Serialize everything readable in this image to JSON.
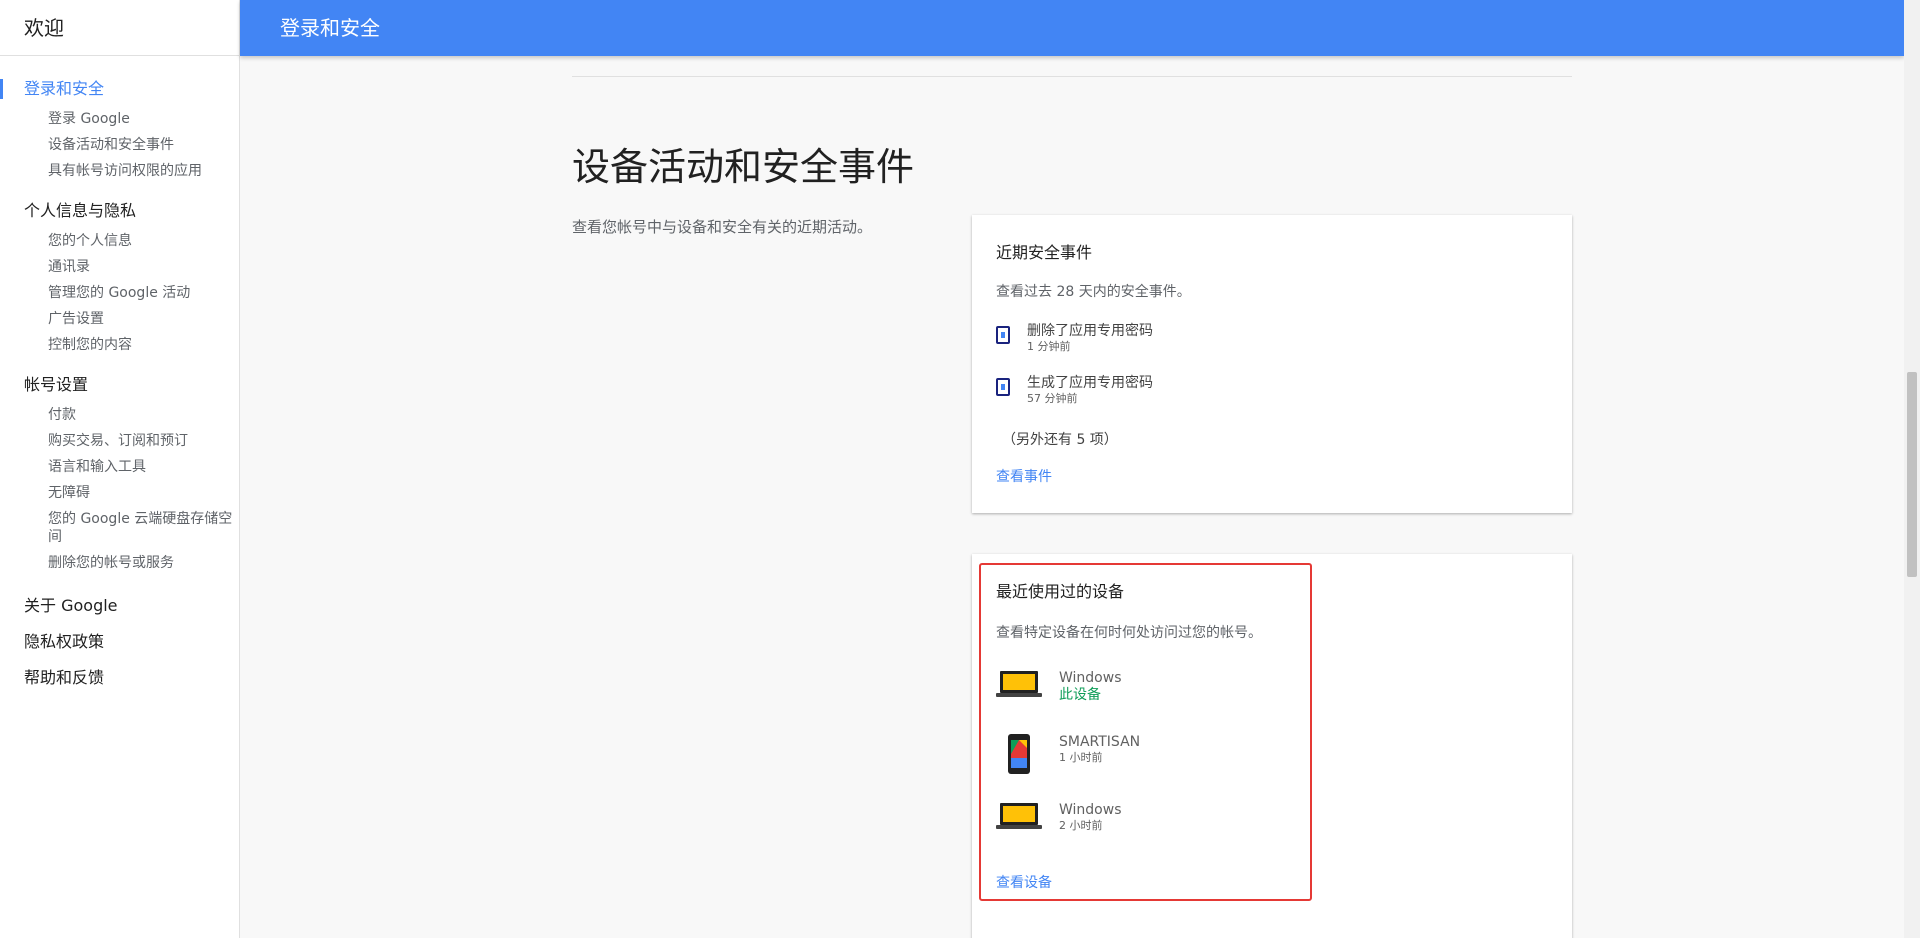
{
  "sidebar": {
    "welcome": "欢迎",
    "sections": [
      {
        "title": "登录和安全",
        "items": [
          "登录 Google",
          "设备活动和安全事件",
          "具有帐号访问权限的应用"
        ]
      },
      {
        "title": "个人信息与隐私",
        "items": [
          "您的个人信息",
          "通讯录",
          "管理您的 Google 活动",
          "广告设置",
          "控制您的内容"
        ]
      },
      {
        "title": "帐号设置",
        "items": [
          "付款",
          "购买交易、订阅和预订",
          "语言和输入工具",
          "无障碍",
          "您的 Google 云端硬盘存储空间",
          "删除您的帐号或服务"
        ]
      }
    ],
    "bottom": [
      "关于 Google",
      "隐私权政策",
      "帮助和反馈"
    ]
  },
  "header": {
    "title": "登录和安全"
  },
  "main": {
    "title": "设备活动和安全事件",
    "description": "查看您帐号中与设备和安全有关的近期活动。",
    "security_events": {
      "title": "近期安全事件",
      "description": "查看过去 28 天内的安全事件。",
      "events": [
        {
          "name": "删除了应用专用密码",
          "time": "1 分钟前",
          "icon": "app-password-icon"
        },
        {
          "name": "生成了应用专用密码",
          "time": "57 分钟前",
          "icon": "app-password-icon"
        }
      ],
      "more": "（另外还有 5 项）",
      "link": "查看事件"
    },
    "recent_devices": {
      "title": "最近使用过的设备",
      "description": "查看特定设备在何时何处访问过您的帐号。",
      "devices": [
        {
          "name": "Windows",
          "status": "此设备",
          "icon": "laptop-icon"
        },
        {
          "name": "SMARTISAN",
          "status": "1 小时前",
          "icon": "phone-icon"
        },
        {
          "name": "Windows",
          "status": "2 小时前",
          "icon": "laptop-icon"
        }
      ],
      "link": "查看设备"
    }
  },
  "colors": {
    "accent": "#4285f4",
    "this_device": "#0f9d58",
    "highlight": "#e53935"
  }
}
